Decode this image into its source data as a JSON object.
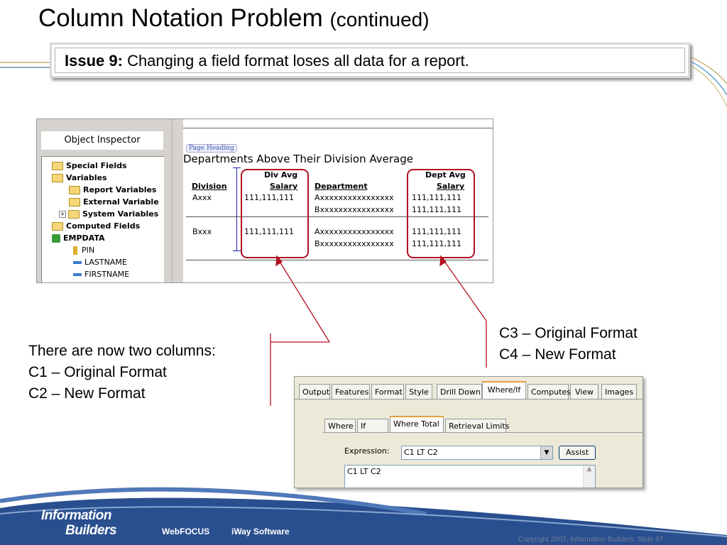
{
  "slide": {
    "title": "Column Notation Problem",
    "title_suffix": "(continued)",
    "issue_label": "Issue 9:",
    "issue_text": "Changing a field format loses all data for a report."
  },
  "object_inspector": {
    "title": "Object Inspector",
    "tree": [
      {
        "label": "Special Fields",
        "icon": "folder-icon",
        "bold": true
      },
      {
        "label": "Variables",
        "icon": "folder-icon",
        "bold": true
      },
      {
        "label": "Report Variables",
        "icon": "folder-icon",
        "bold": true
      },
      {
        "label": "External Variable",
        "icon": "folder-icon",
        "bold": true
      },
      {
        "label": "System Variables",
        "icon": "folder-icon",
        "bold": true
      },
      {
        "label": "Computed Fields",
        "icon": "folder-icon",
        "bold": true
      },
      {
        "label": "EMPDATA",
        "icon": "database-icon",
        "bold": true
      },
      {
        "label": "PIN",
        "icon": "key-icon",
        "bold": false
      },
      {
        "label": "LASTNAME",
        "icon": "field-icon",
        "bold": false
      },
      {
        "label": "FIRSTNAME",
        "icon": "field-icon",
        "bold": false
      }
    ]
  },
  "report": {
    "page_heading_tag": "Page Heading",
    "title": "Departments Above Their Division Average",
    "col_division": "Division",
    "col_divavg_1": "Div Avg",
    "col_divavg_2": "Salary",
    "col_department": "Department",
    "col_deptavg_1": "Dept Avg",
    "col_deptavg_2": "Salary",
    "rows": [
      {
        "division": "Axxx",
        "divavg": "111,111,111",
        "dept": "Axxxxxxxxxxxxxxxxxx",
        "deptavg": "111,111,111"
      },
      {
        "division": "",
        "divavg": "",
        "dept": "Bxxxxxxxxxxxxxxxxxx",
        "deptavg": "111,111,111"
      },
      {
        "division": "Bxxx",
        "divavg": "111,111,111",
        "dept": "Axxxxxxxxxxxxxxxxxx",
        "deptavg": "111,111,111"
      },
      {
        "division": "",
        "divavg": "",
        "dept": "Bxxxxxxxxxxxxxxxxxx",
        "deptavg": "111,111,111"
      }
    ]
  },
  "notes": {
    "left": [
      "There are now two columns:",
      "C1 – Original Format",
      "C2 – New Format"
    ],
    "right": [
      "C3 – Original Format",
      "C4 – New Format"
    ]
  },
  "dialog": {
    "tabs": [
      "Output",
      "Features",
      "Format",
      "Style",
      "Drill Down",
      "Where/If",
      "Computes",
      "View",
      "Images"
    ],
    "active_tab": "Where/If",
    "inner_tabs": [
      "Where",
      "If",
      "Where Total",
      "Retrieval Limits"
    ],
    "active_inner_tab": "Where Total",
    "expression_label": "Expression:",
    "expression_value": "C1 LT C2",
    "assist_label": "Assist",
    "expression_text": "C1 LT C2"
  },
  "footer": {
    "logo_line1": "Information",
    "logo_line2": "Builders",
    "product1": "WebFOCUS",
    "product2": "iWay Software",
    "copyright": "Copyright 2007, Information Builders. Slide 47"
  },
  "colors": {
    "annotation_red": "#b01020",
    "footer_blue": "#2a4f8f"
  }
}
